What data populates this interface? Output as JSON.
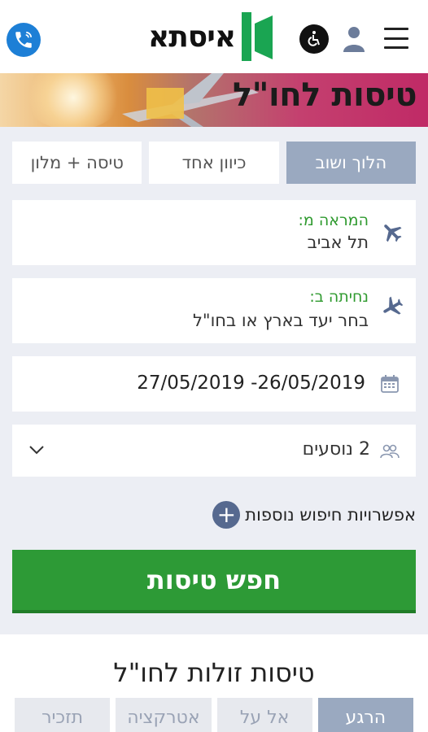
{
  "header": {
    "logo_text": "איסתא",
    "phone_icon": "phone-icon",
    "accessibility_icon": "accessibility-icon",
    "user_icon": "user-icon",
    "menu_icon": "hamburger-menu-icon"
  },
  "banner": {
    "title": "טיסות לחו\"ל"
  },
  "trip_tabs": [
    {
      "label": "הלוך ושוב",
      "active": true
    },
    {
      "label": "כיוון אחד",
      "active": false
    },
    {
      "label": "טיסה + מלון",
      "active": false
    }
  ],
  "from": {
    "label": "המראה מ:",
    "value": "תל אביב"
  },
  "to": {
    "label": "נחיתה ב:",
    "value": "בחר יעד בארץ או בחו\"ל"
  },
  "dates": {
    "value": "27/05/2019 -26/05/2019"
  },
  "passengers": {
    "value": "2 נוסעים"
  },
  "more_options": {
    "label": "אפשרויות חיפוש נוספות"
  },
  "search_button": {
    "label": "חפש טיסות"
  },
  "cheap_flights": {
    "title": "טיסות זולות לחו\"ל",
    "tabs": [
      {
        "label": "הרגע",
        "active": true
      },
      {
        "label": "אל על",
        "active": false
      },
      {
        "label": "אטרקציה",
        "active": false
      },
      {
        "label": "תזכיר",
        "active": false
      }
    ]
  },
  "colors": {
    "brand_green": "#2d9a36",
    "active_tab": "#9aa9c0",
    "phone_blue": "#1d7fd6",
    "label_green": "#2f9a2f"
  }
}
